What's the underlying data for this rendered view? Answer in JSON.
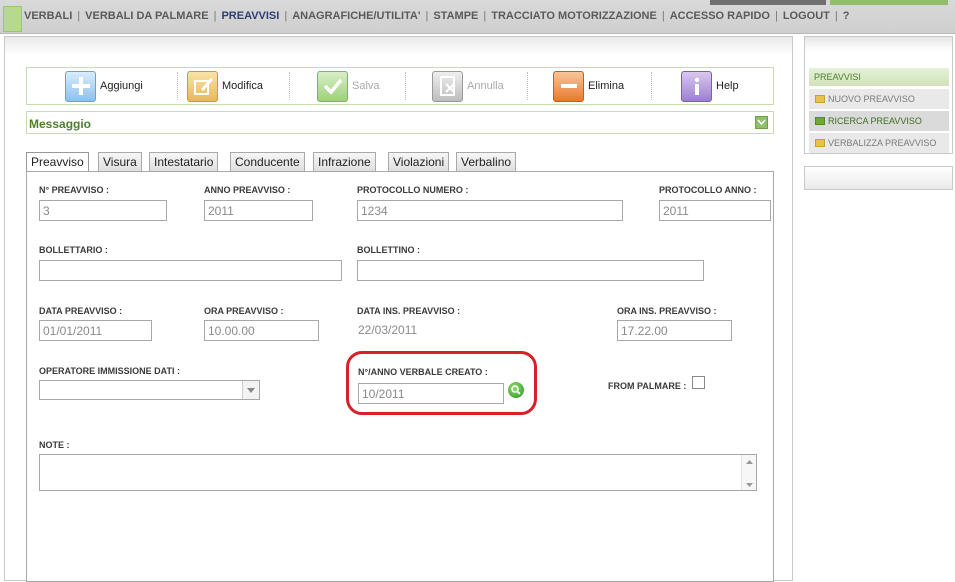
{
  "nav": {
    "items": [
      {
        "label": "VERBALI",
        "active": false
      },
      {
        "label": "VERBALI DA PALMARE",
        "active": false
      },
      {
        "label": "PREAVVISI",
        "active": true
      },
      {
        "label": "ANAGRAFICHE/UTILITA'",
        "active": false
      },
      {
        "label": "STAMPE",
        "active": false
      },
      {
        "label": "TRACCIATO MOTORIZZAZIONE",
        "active": false
      },
      {
        "label": "ACCESSO RAPIDO",
        "active": false
      },
      {
        "label": "LOGOUT",
        "active": false
      },
      {
        "label": "?",
        "active": false
      }
    ]
  },
  "toolbar": {
    "aggiungi": "Aggiungi",
    "modifica": "Modifica",
    "salva": "Salva",
    "annulla": "Annulla",
    "elimina": "Elimina",
    "help": "Help"
  },
  "message_bar": {
    "label": "Messaggio"
  },
  "tabs": [
    "Preavviso",
    "Visura",
    "Intestatario",
    "Conducente",
    "Infrazione",
    "Violazioni",
    "Verbalino"
  ],
  "form": {
    "n_preavviso": {
      "label": "N° PREAVVISO :",
      "value": "3"
    },
    "anno_preavviso": {
      "label": "ANNO PREAVVISO :",
      "value": "2011"
    },
    "protocollo_numero": {
      "label": "PROTOCOLLO NUMERO :",
      "value": "1234"
    },
    "protocollo_anno": {
      "label": "PROTOCOLLO ANNO :",
      "value": "2011"
    },
    "bollettario": {
      "label": "BOLLETTARIO :",
      "value": ""
    },
    "bollettino": {
      "label": "BOLLETTINO :",
      "value": ""
    },
    "data_preavviso": {
      "label": "DATA PREAVVISO :",
      "value": "01/01/2011"
    },
    "ora_preavviso": {
      "label": "ORA PREAVVISO :",
      "value": "10.00.00"
    },
    "data_ins_preavviso": {
      "label": "DATA INS. PREAVVISO :",
      "value": "22/03/2011"
    },
    "ora_ins_preavviso": {
      "label": "ORA INS. PREAVVISO :",
      "value": "17.22.00"
    },
    "operatore": {
      "label": "OPERATORE IMMISSIONE DATI :",
      "value": ""
    },
    "n_anno_verbale": {
      "label": "N°/ANNO VERBALE CREATO :",
      "value": "10/2011"
    },
    "from_palmare": {
      "label": "FROM PALMARE :",
      "checked": false
    },
    "note": {
      "label": "NOTE :",
      "value": ""
    }
  },
  "sidebar": {
    "title": "PREAVVISI",
    "items": [
      {
        "label": "NUOVO PREAVVISO",
        "active": false,
        "color": "#e8c24a"
      },
      {
        "label": "RICERCA PREAVVISO",
        "active": true,
        "color": "#6fa63d"
      },
      {
        "label": "VERBALIZZA PREAVVISO",
        "active": false,
        "color": "#e8c24a"
      }
    ]
  },
  "colors": {
    "accent_green": "#4e7d2f",
    "highlight_red": "#d9202a",
    "nav_active": "#2d3e73"
  }
}
